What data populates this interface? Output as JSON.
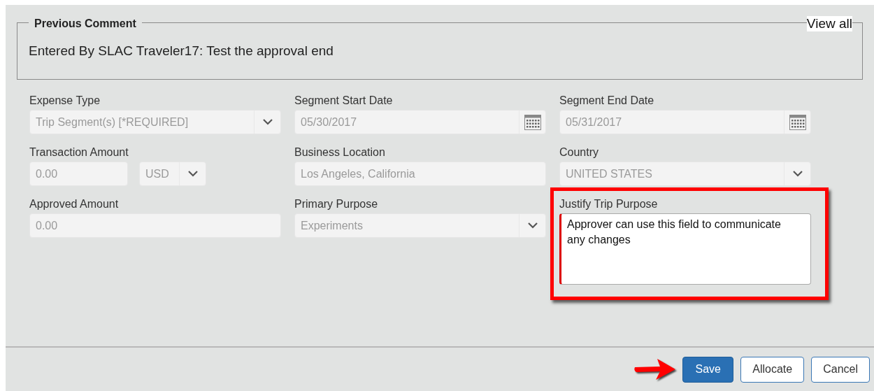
{
  "previous_comment": {
    "title": "Previous Comment",
    "text": "Entered By SLAC Traveler17: Test the approval end",
    "link": "View all"
  },
  "fields": [
    {
      "label": "Expense Type",
      "kind": "select",
      "value": "Trip Segment(s) [*REQUIRED]",
      "disabled": true,
      "highlighted": false
    },
    {
      "label": "Segment Start Date",
      "kind": "date",
      "value": "05/30/2017",
      "disabled": true,
      "highlighted": false
    },
    {
      "label": "Segment End Date",
      "kind": "date",
      "value": "05/31/2017",
      "disabled": true,
      "highlighted": false
    },
    {
      "label": "Transaction Amount",
      "kind": "amount",
      "value": "0.00",
      "currency": "USD",
      "disabled": true,
      "highlighted": false
    },
    {
      "label": "Business Location",
      "kind": "text",
      "value": "Los Angeles, California",
      "disabled": true,
      "highlighted": false
    },
    {
      "label": "Country",
      "kind": "select",
      "value": "UNITED STATES",
      "disabled": true,
      "highlighted": false
    },
    {
      "label": "Approved Amount",
      "kind": "text",
      "value": "0.00",
      "disabled": true,
      "highlighted": false
    },
    {
      "label": "Primary Purpose",
      "kind": "select",
      "value": "Experiments",
      "disabled": true,
      "highlighted": false
    },
    {
      "label": "Justify Trip Purpose",
      "kind": "textarea",
      "value": "Approver can use this field to communicate any changes",
      "disabled": false,
      "highlighted": true
    }
  ],
  "buttons": [
    {
      "label": "Save",
      "primary": true,
      "pointed": true
    },
    {
      "label": "Allocate",
      "primary": false,
      "pointed": false
    },
    {
      "label": "Cancel",
      "primary": false,
      "pointed": false
    }
  ]
}
